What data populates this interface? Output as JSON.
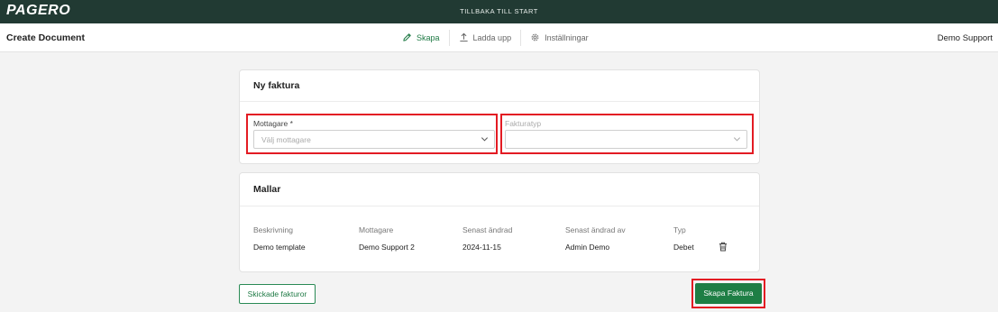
{
  "app": {
    "logo": "PAGERO",
    "back_link": "TILLBAKA TILL START"
  },
  "header": {
    "title": "Create Document",
    "nav": [
      {
        "label": "Skapa",
        "icon": "pencil-icon",
        "active": true
      },
      {
        "label": "Ladda upp",
        "icon": "upload-icon",
        "active": false
      },
      {
        "label": "Inställningar",
        "icon": "gear-icon",
        "active": false
      }
    ],
    "user": "Demo Support"
  },
  "new_invoice": {
    "title": "Ny faktura",
    "recipient": {
      "label": "Mottagare *",
      "placeholder": "Välj mottagare",
      "value": ""
    },
    "invoice_type": {
      "label": "Fakturatyp",
      "value": ""
    }
  },
  "templates": {
    "title": "Mallar",
    "columns": [
      "Beskrivning",
      "Mottagare",
      "Senast ändrad",
      "Senast ändrad av",
      "Typ"
    ],
    "rows": [
      {
        "description": "Demo template",
        "recipient": "Demo Support 2",
        "modified": "2024-11-15",
        "modified_by": "Admin Demo",
        "type": "Debet"
      }
    ]
  },
  "actions": {
    "sent_invoices": "Skickade fakturor",
    "create_invoice": "Skapa Faktura"
  },
  "colors": {
    "topbar": "#213a33",
    "accent": "#1e7e45",
    "highlight": "#e31b23"
  }
}
